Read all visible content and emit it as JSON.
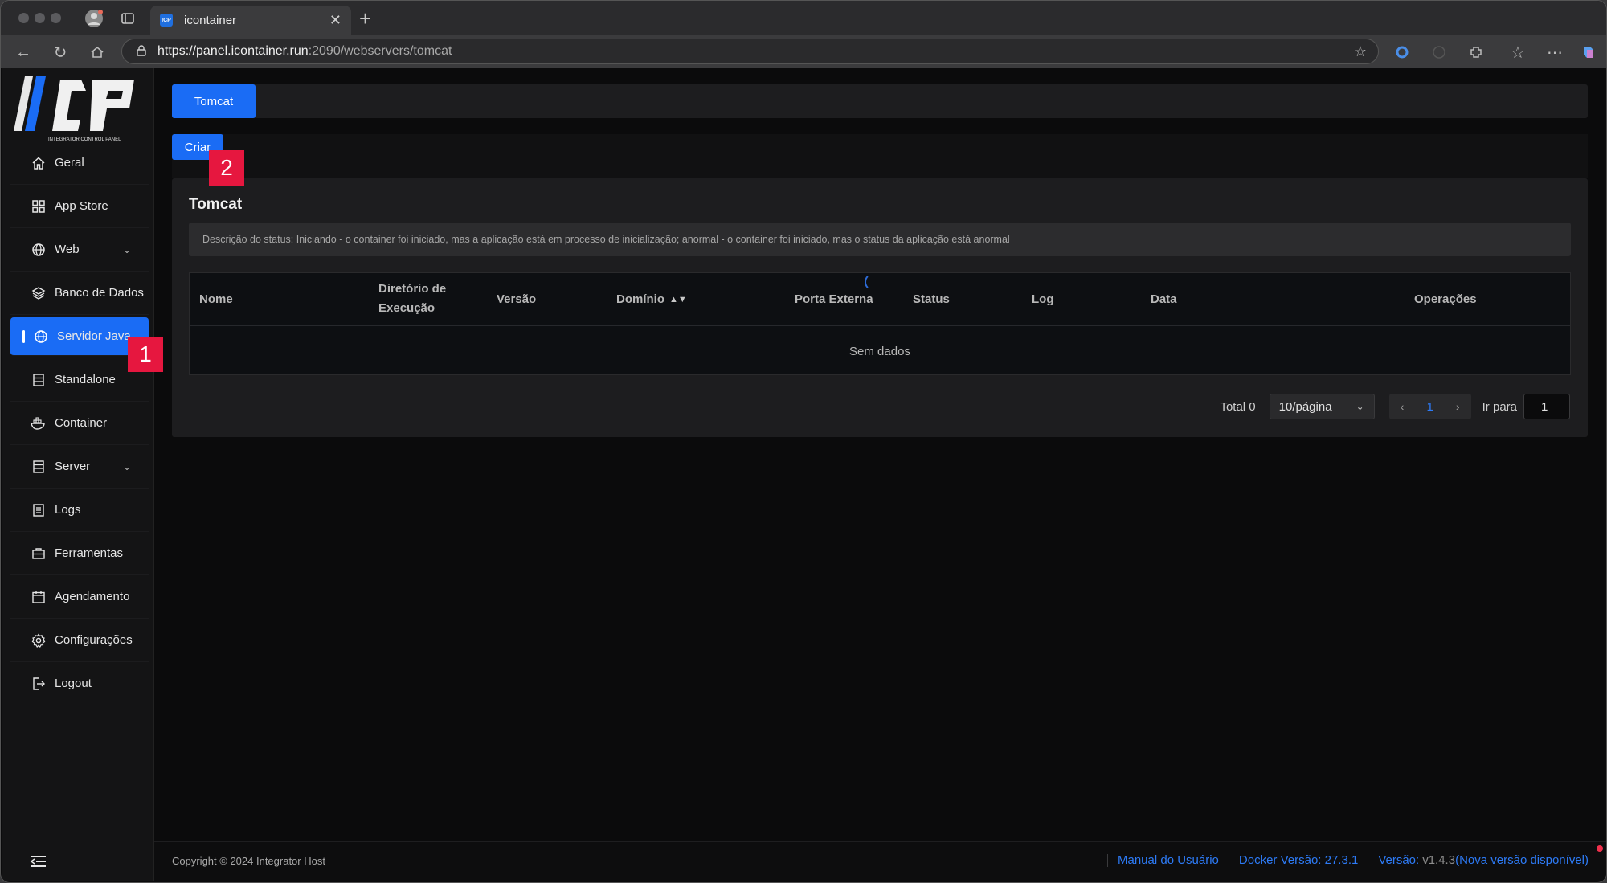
{
  "browser": {
    "tab_title": "icontainer",
    "favicon_text": "ICP",
    "url_host": "https://panel.icontainer.run",
    "url_path": ":2090/webservers/tomcat"
  },
  "logo": {
    "text": "ICP",
    "tagline": "INTEGRATOR CONTROL PANEL"
  },
  "sidebar": {
    "items": [
      {
        "label": "Geral",
        "icon": "home-icon"
      },
      {
        "label": "App Store",
        "icon": "grid-icon"
      },
      {
        "label": "Web",
        "icon": "globe-icon",
        "expandable": true
      },
      {
        "label": "Banco de Dados",
        "icon": "layers-icon"
      },
      {
        "label": "Servidor Java",
        "icon": "globe-icon",
        "active": true
      },
      {
        "label": "Standalone",
        "icon": "server-icon"
      },
      {
        "label": "Container",
        "icon": "docker-icon"
      },
      {
        "label": "Server",
        "icon": "server-icon",
        "expandable": true
      },
      {
        "label": "Logs",
        "icon": "list-icon"
      },
      {
        "label": "Ferramentas",
        "icon": "toolbox-icon"
      },
      {
        "label": "Agendamento",
        "icon": "calendar-icon"
      },
      {
        "label": "Configurações",
        "icon": "gear-icon"
      },
      {
        "label": "Logout",
        "icon": "logout-icon"
      }
    ]
  },
  "annotations": {
    "badge1": "1",
    "badge2": "2"
  },
  "main": {
    "tab_label": "Tomcat",
    "create_button": "Criar",
    "card_title": "Tomcat",
    "status_description": "Descrição do status: Iniciando - o container foi iniciado, mas a aplicação está em processo de inicialização; anormal - o container foi iniciado, mas o status da aplicação está anormal",
    "table": {
      "columns": [
        "Nome",
        "Diretório de",
        "Execução",
        "Versão",
        "Domínio",
        "Porta Externa",
        "Status",
        "Log",
        "Data",
        "Operações"
      ],
      "empty_text": "Sem dados"
    },
    "pagination": {
      "total": "Total 0",
      "page_size": "10/página",
      "current_page": "1",
      "goto_label": "Ir para",
      "goto_value": "1"
    }
  },
  "footer": {
    "copyright": "Copyright © 2024 Integrator Host",
    "manual": "Manual do Usuário",
    "docker": "Docker Versão: 27.3.1",
    "version_label": "Versão:",
    "version": "v1.4.3",
    "new_version": "(Nova versão disponível)"
  },
  "colors": {
    "accent": "#1a6cf5",
    "badge": "#e6173f",
    "link": "#2d7bf7"
  }
}
